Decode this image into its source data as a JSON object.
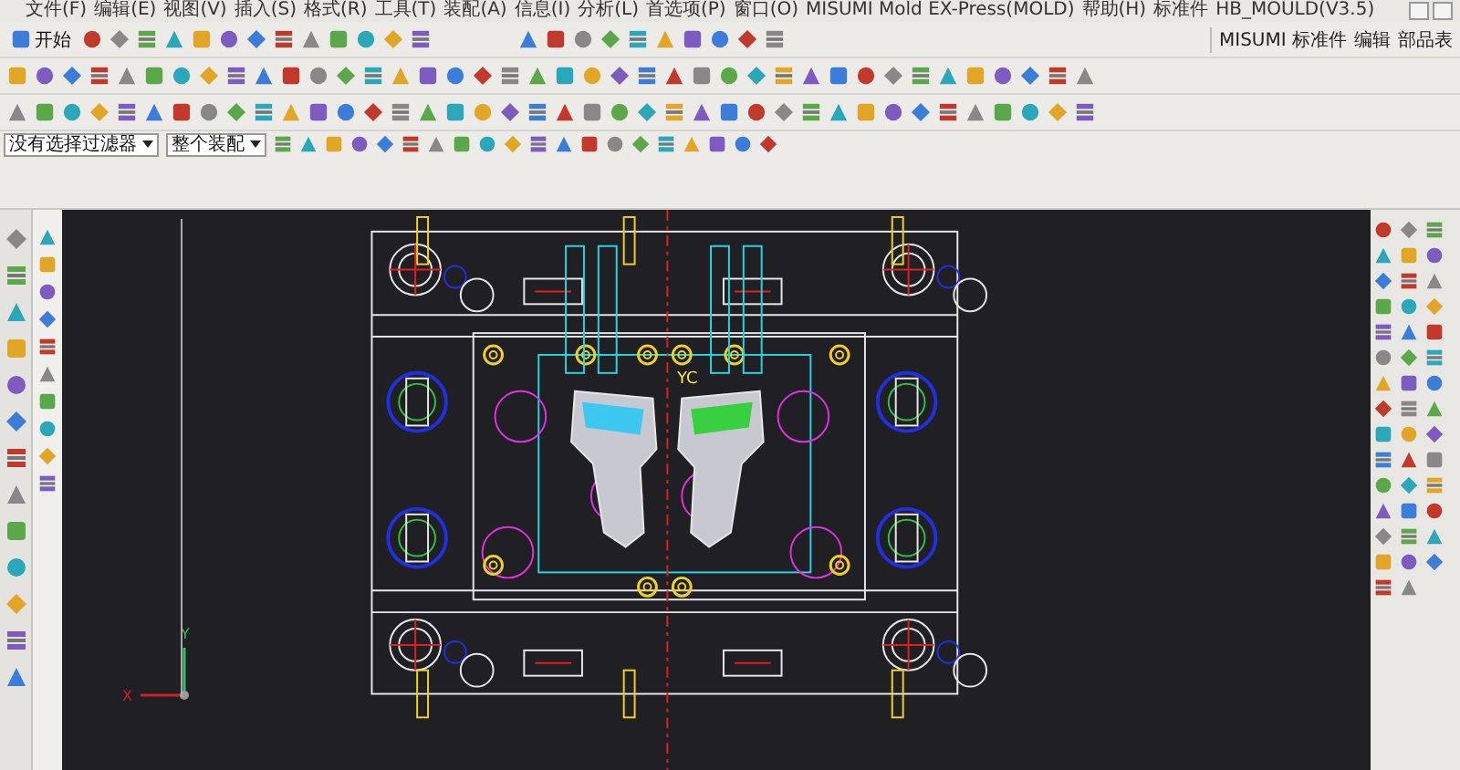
{
  "menu": [
    "文件(F)",
    "编辑(E)",
    "视图(V)",
    "插入(S)",
    "格式(R)",
    "工具(T)",
    "装配(A)",
    "信息(I)",
    "分析(L)",
    "首选项(P)",
    "窗口(O)",
    "MISUMI Mold EX-Press(MOLD)",
    "帮助(H)",
    "标准件",
    "HB_MOULD(V3.5)"
  ],
  "toolbar": {
    "start_button": "开始",
    "right_menu": [
      "MISUMI 标准件",
      "编辑",
      "部品表"
    ]
  },
  "filters": {
    "selection_filter": "没有选择过滤器",
    "scope": "整个装配"
  },
  "viewport": {
    "wcs_label": "YC",
    "axis_x": "X",
    "axis_y": "Y"
  }
}
